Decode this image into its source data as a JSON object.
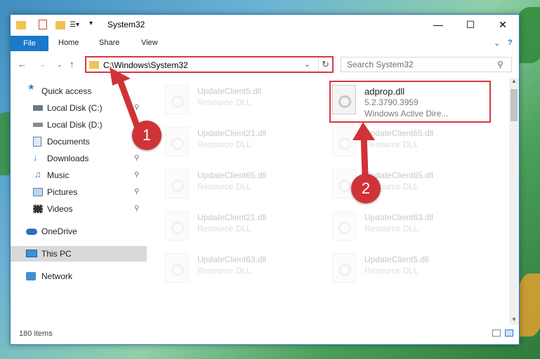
{
  "window": {
    "title": "System32"
  },
  "ribbon": {
    "tabs": [
      "File",
      "Home",
      "Share",
      "View"
    ]
  },
  "address": {
    "path": "C:\\Windows\\System32"
  },
  "search": {
    "placeholder": "Search System32"
  },
  "sidebar": {
    "items": [
      {
        "label": "Quick access",
        "icon": "star-icon"
      },
      {
        "label": "Local Disk (C:)",
        "icon": "drive-icon"
      },
      {
        "label": "Local Disk (D:)",
        "icon": "drive-icon"
      },
      {
        "label": "Documents",
        "icon": "documents-icon"
      },
      {
        "label": "Downloads",
        "icon": "downloads-icon"
      },
      {
        "label": "Music",
        "icon": "music-icon"
      },
      {
        "label": "Pictures",
        "icon": "pictures-icon"
      },
      {
        "label": "Videos",
        "icon": "videos-icon"
      },
      {
        "label": "OneDrive",
        "icon": "cloud-icon"
      },
      {
        "label": "This PC",
        "icon": "computer-icon"
      },
      {
        "label": "Network",
        "icon": "network-icon"
      }
    ]
  },
  "files": [
    {
      "name": "UpdateClient5.dll",
      "desc": "Resource DLL"
    },
    {
      "name": "adprop.dll",
      "desc": "5.2.3790.3959",
      "desc2": "Windows Active Dire..."
    },
    {
      "name": "UpdateClient21.dll",
      "desc": "Resource DLL"
    },
    {
      "name": "UpdateClient65.dll",
      "desc": "Resource DLL"
    },
    {
      "name": "UpdateClient65.dll",
      "desc": "Resource DLL"
    },
    {
      "name": "UpdateClient65.dll",
      "desc": "Resource DLL"
    },
    {
      "name": "UpdateClient21.dll",
      "desc": "Resource DLL"
    },
    {
      "name": "UpdateClient63.dll",
      "desc": "Resource DLL"
    },
    {
      "name": "UpdateClient63.dll",
      "desc": "Resource DLL"
    },
    {
      "name": "UpdateClient5.dll",
      "desc": "Resource DLL"
    }
  ],
  "status": {
    "items": "180 items"
  },
  "annotations": {
    "step1": "1",
    "step2": "2"
  }
}
